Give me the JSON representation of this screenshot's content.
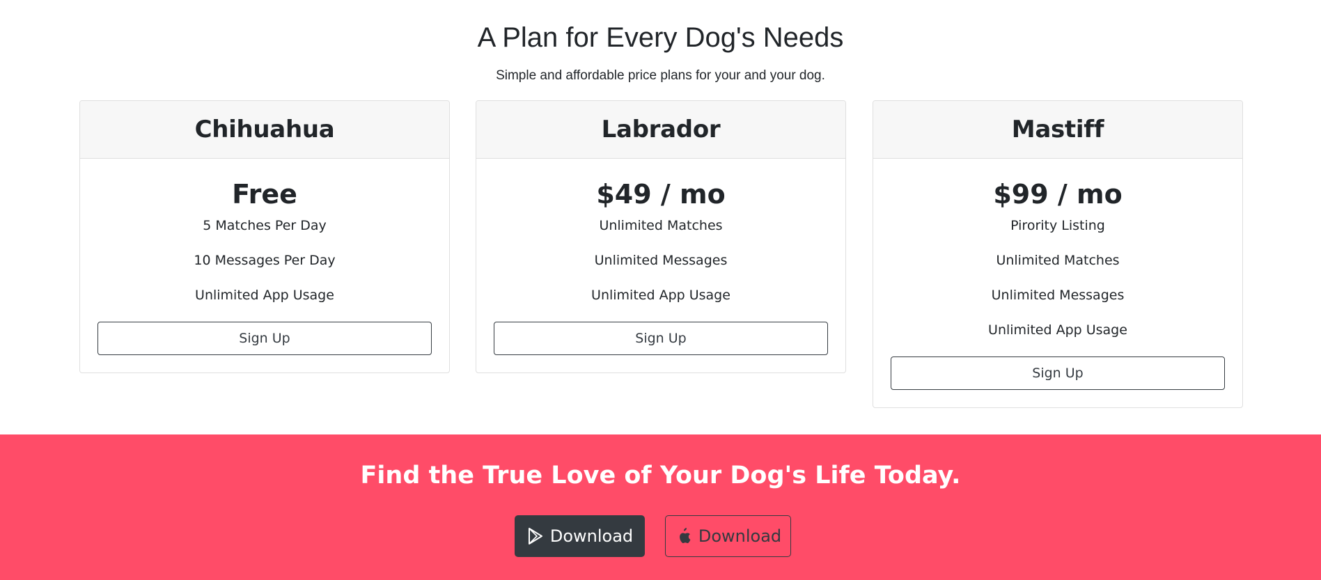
{
  "pricing": {
    "title": "A Plan for Every Dog's Needs",
    "subtitle": "Simple and affordable price plans for your and your dog."
  },
  "plans": [
    {
      "name": "Chihuahua",
      "price": "Free",
      "features": [
        "5 Matches Per Day",
        "10 Messages Per Day",
        "Unlimited App Usage"
      ],
      "button_label": "Sign Up"
    },
    {
      "name": "Labrador",
      "price": "$49 / mo",
      "features": [
        "Unlimited Matches",
        "Unlimited Messages",
        "Unlimited App Usage"
      ],
      "button_label": "Sign Up"
    },
    {
      "name": "Mastiff",
      "price": "$99 / mo",
      "features": [
        "Pirority Listing",
        "Unlimited Matches",
        "Unlimited Messages",
        "Unlimited App Usage"
      ],
      "button_label": "Sign Up"
    }
  ],
  "cta": {
    "title": "Find the True Love of Your Dog's Life Today.",
    "background_color": "#ff4c68",
    "buttons": [
      {
        "label": "Download",
        "icon": "google-play-icon",
        "style": "dark"
      },
      {
        "label": "Download",
        "icon": "apple-icon",
        "style": "outline"
      }
    ]
  }
}
